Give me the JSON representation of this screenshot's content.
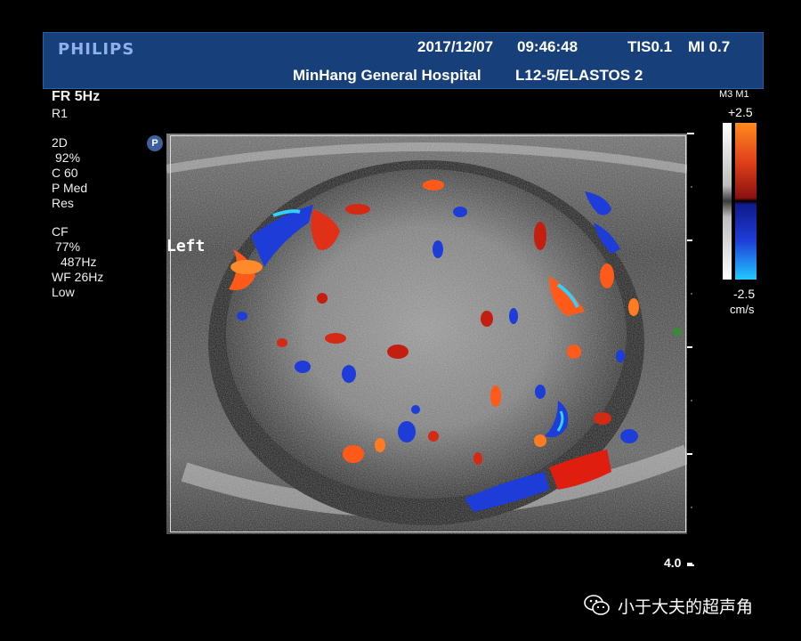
{
  "header": {
    "brand": "PHILIPS",
    "date": "2017/12/07",
    "time": "09:46:48",
    "tis": "TIS0.1",
    "mi": "MI 0.7",
    "hospital": "MinHang General Hospital",
    "probe": "L12-5/ELASTOS 2"
  },
  "left_panel": {
    "fr": "FR 5Hz",
    "r": "R1",
    "mode_2d": {
      "title": "2D",
      "gain": "92%",
      "c": "C 60",
      "p": "P Med",
      "res": "Res"
    },
    "mode_cf": {
      "title": "CF",
      "gain": "77%",
      "freq": "487Hz",
      "wf": "WF 26Hz",
      "level": "Low"
    }
  },
  "image": {
    "side_label": "Left",
    "marker": "P",
    "depth": "4.0"
  },
  "colorbar": {
    "map_label": "M3 M1",
    "max": "+2.5",
    "min": "-2.5",
    "unit": "cm/s",
    "colors": {
      "positive_bright": "#ff8a1e",
      "positive_dark": "#8a1010",
      "negative_dark": "#101a8a",
      "negative_bright": "#22c8ff"
    }
  },
  "watermark": {
    "icon": "wechat-icon",
    "text": "小于大夫的超声角"
  }
}
